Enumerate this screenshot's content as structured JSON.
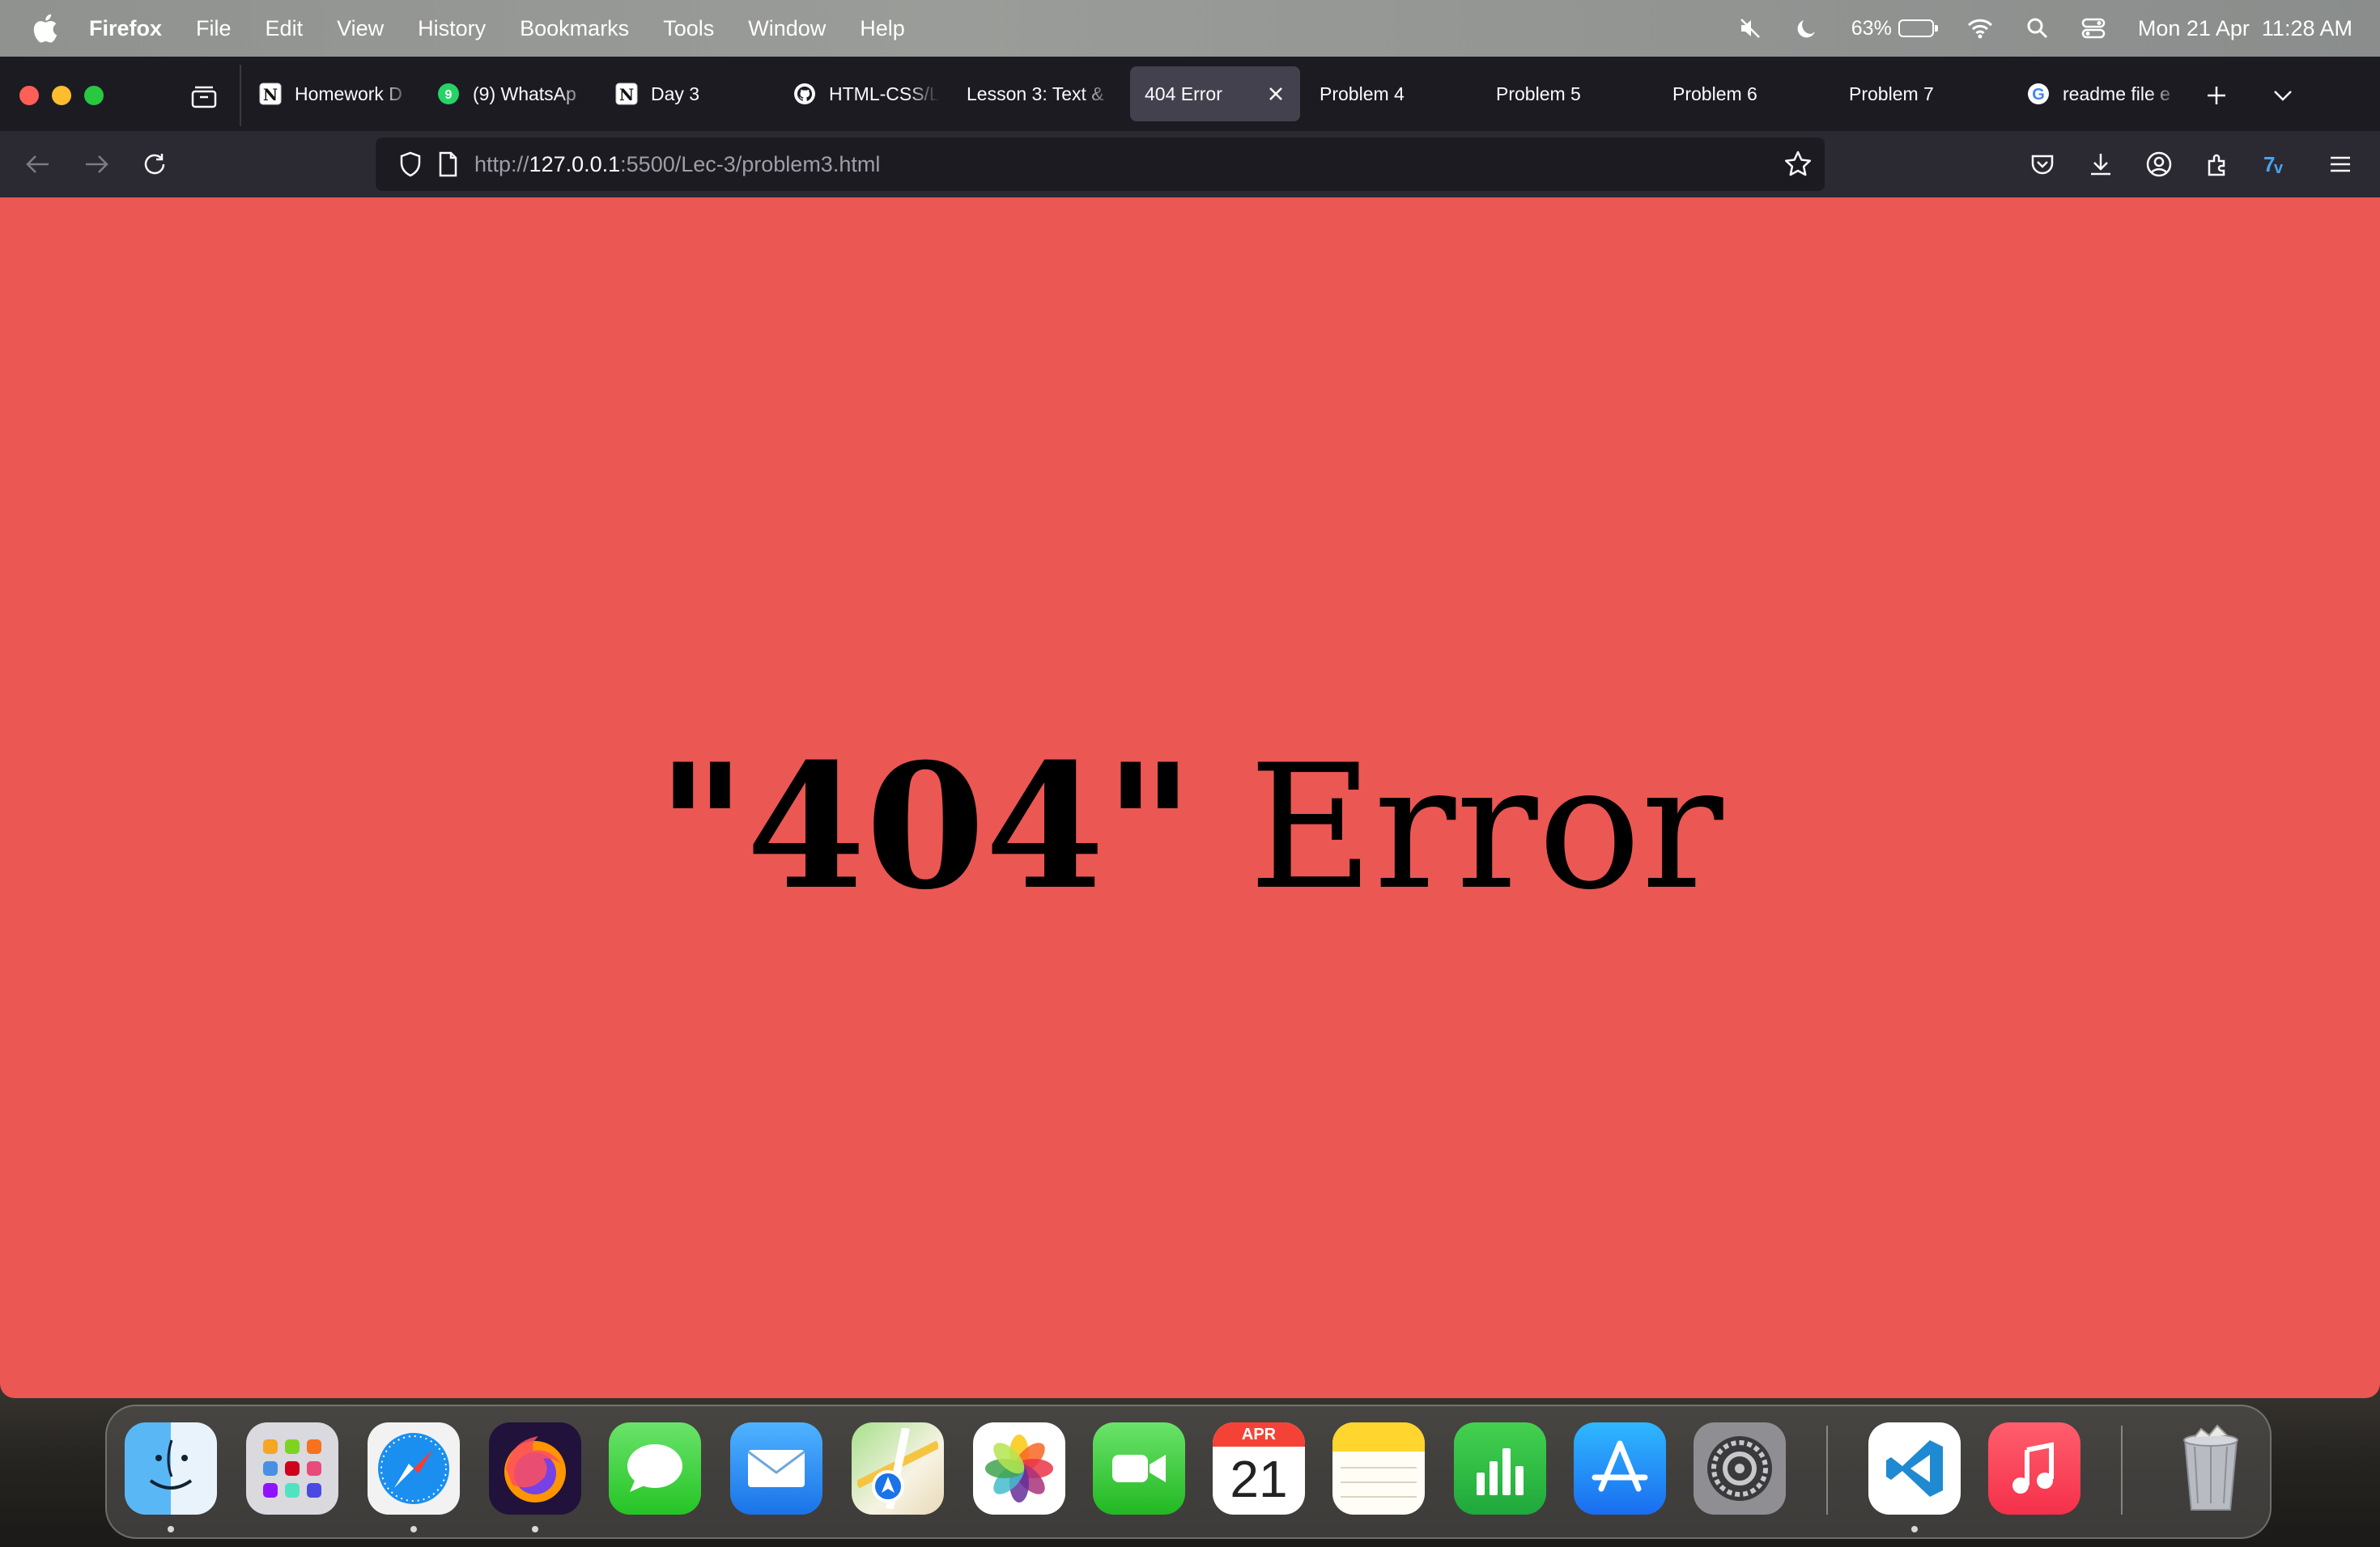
{
  "menubar": {
    "app_name": "Firefox",
    "menus": [
      "File",
      "Edit",
      "View",
      "History",
      "Bookmarks",
      "Tools",
      "Window",
      "Help"
    ],
    "battery_percent": "63%",
    "battery_level": 0.63,
    "datetime": "Mon 21 Apr  11:28 AM",
    "status_icons": [
      "mute-icon",
      "moon-icon",
      "battery-icon",
      "wifi-icon",
      "spotlight-icon",
      "control-center-icon"
    ]
  },
  "tabs": [
    {
      "label": "Homework D",
      "icon": "notion-icon",
      "active": false
    },
    {
      "label": "(9) WhatsAp",
      "icon": "whatsapp-icon",
      "badge": "9",
      "active": false
    },
    {
      "label": "Day 3",
      "icon": "notion-icon",
      "active": false
    },
    {
      "label": "HTML-CSS/L",
      "icon": "github-icon",
      "active": false
    },
    {
      "label": "Lesson 3: Text &",
      "icon": "",
      "active": false
    },
    {
      "label": "404 Error",
      "icon": "",
      "active": true
    },
    {
      "label": "Problem 4",
      "icon": "",
      "active": false
    },
    {
      "label": "Problem 5",
      "icon": "",
      "active": false
    },
    {
      "label": "Problem 6",
      "icon": "",
      "active": false
    },
    {
      "label": "Problem 7",
      "icon": "",
      "active": false
    },
    {
      "label": "readme file e",
      "icon": "google-icon",
      "active": false
    }
  ],
  "urlbar": {
    "prefix": "http://",
    "host": "127.0.0.1",
    "path": ":5500/Lec-3/problem3.html"
  },
  "page": {
    "heading_quoted": "\"404\"",
    "heading_rest": " Error",
    "background_color": "#eb5753"
  },
  "dock": {
    "apps": [
      "Finder",
      "Launchpad",
      "Safari",
      "Firefox",
      "Messages",
      "Mail",
      "Maps",
      "Photos",
      "FaceTime",
      "Calendar",
      "Notes",
      "Numbers",
      "App Store",
      "System Settings",
      "Visual Studio Code",
      "Music",
      "Trash"
    ],
    "calendar_month": "APR",
    "calendar_day": "21"
  }
}
